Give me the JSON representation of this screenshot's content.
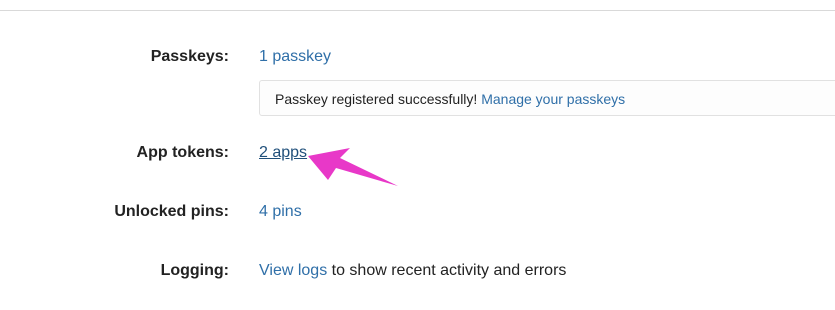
{
  "rows": {
    "passkeys": {
      "label": "Passkeys:",
      "link": "1 passkey"
    },
    "notice": {
      "text": "Passkey registered successfully! ",
      "link": "Manage your passkeys"
    },
    "app_tokens": {
      "label": "App tokens:",
      "link": "2 apps"
    },
    "unlocked_pins": {
      "label": "Unlocked pins:",
      "link": "4 pins"
    },
    "logging": {
      "label": "Logging:",
      "link": "View logs",
      "suffix": " to show recent activity and errors"
    }
  },
  "annotation": {
    "arrow_color": "#e838c8",
    "icon": "pointer-arrow-icon"
  },
  "colors": {
    "link": "#2f6fa8",
    "link_active": "#1f4f7a"
  }
}
